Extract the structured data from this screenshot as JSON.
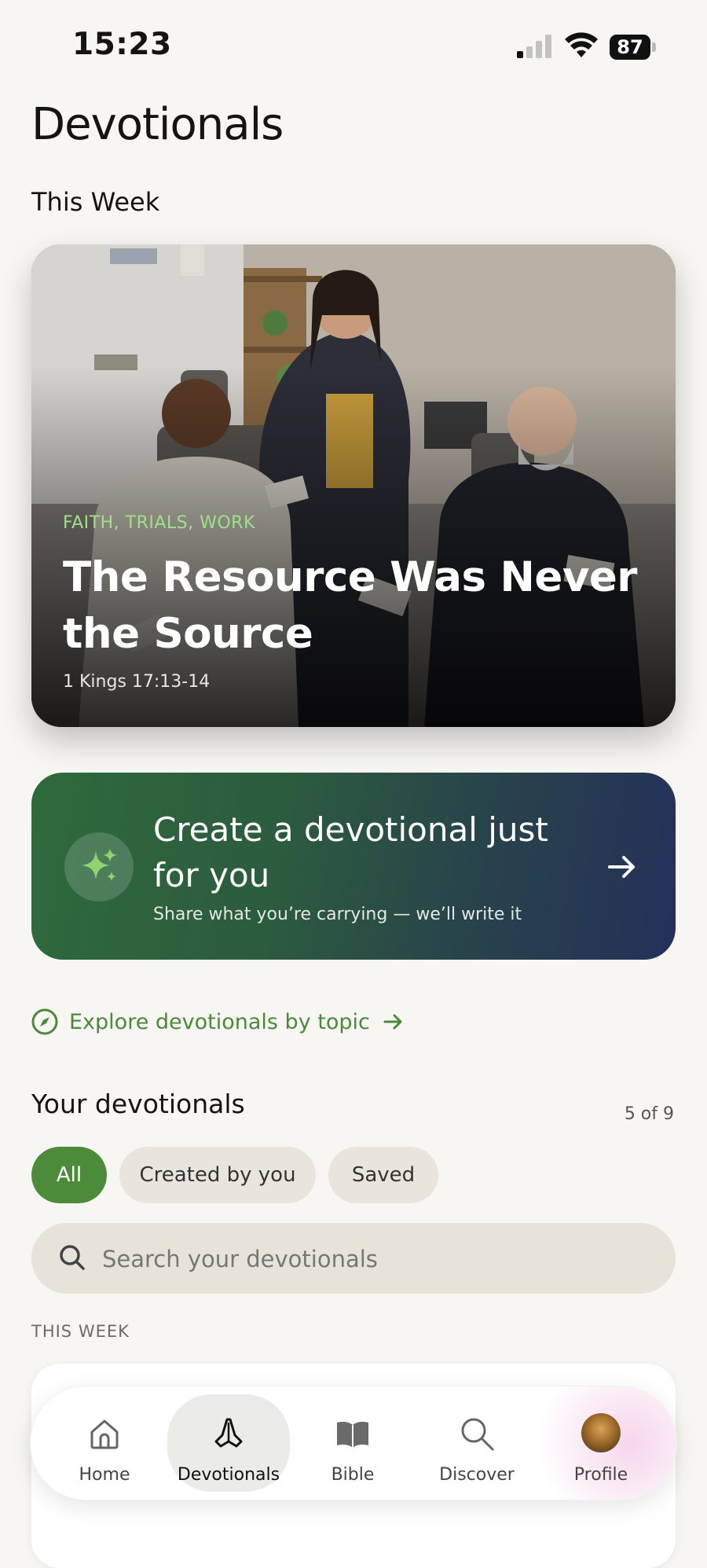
{
  "status_bar": {
    "time": "15:23",
    "battery": "87"
  },
  "page": {
    "title": "Devotionals",
    "section_this_week": "This Week"
  },
  "featured": {
    "tags": "FAITH, TRIALS, WORK",
    "title": "The Resource Was Never the Source",
    "reference": "1 Kings 17:13-14"
  },
  "create_card": {
    "title": "Create a devotional just for you",
    "subtitle": "Share what you’re carrying — we’ll write it"
  },
  "explore": {
    "label": "Explore devotionals by topic"
  },
  "your_devotionals": {
    "title": "Your devotionals",
    "count": "5 of 9",
    "filters": [
      "All",
      "Created by you",
      "Saved"
    ],
    "active_filter": "All",
    "search_placeholder": "Search your devotionals",
    "group_label": "THIS WEEK"
  },
  "tab_bar": {
    "tabs": [
      {
        "label": "Home",
        "icon": "home-icon"
      },
      {
        "label": "Devotionals",
        "icon": "praying-hands-icon"
      },
      {
        "label": "Bible",
        "icon": "book-icon"
      },
      {
        "label": "Discover",
        "icon": "search-icon"
      },
      {
        "label": "Profile",
        "icon": "avatar"
      }
    ],
    "active": "Devotionals"
  },
  "colors": {
    "accent_green": "#4c8b3a",
    "tag_green": "#9fe08a",
    "background": "#f7f6f2",
    "create_card_start": "#2e6a3c",
    "create_card_end": "#25305a"
  }
}
